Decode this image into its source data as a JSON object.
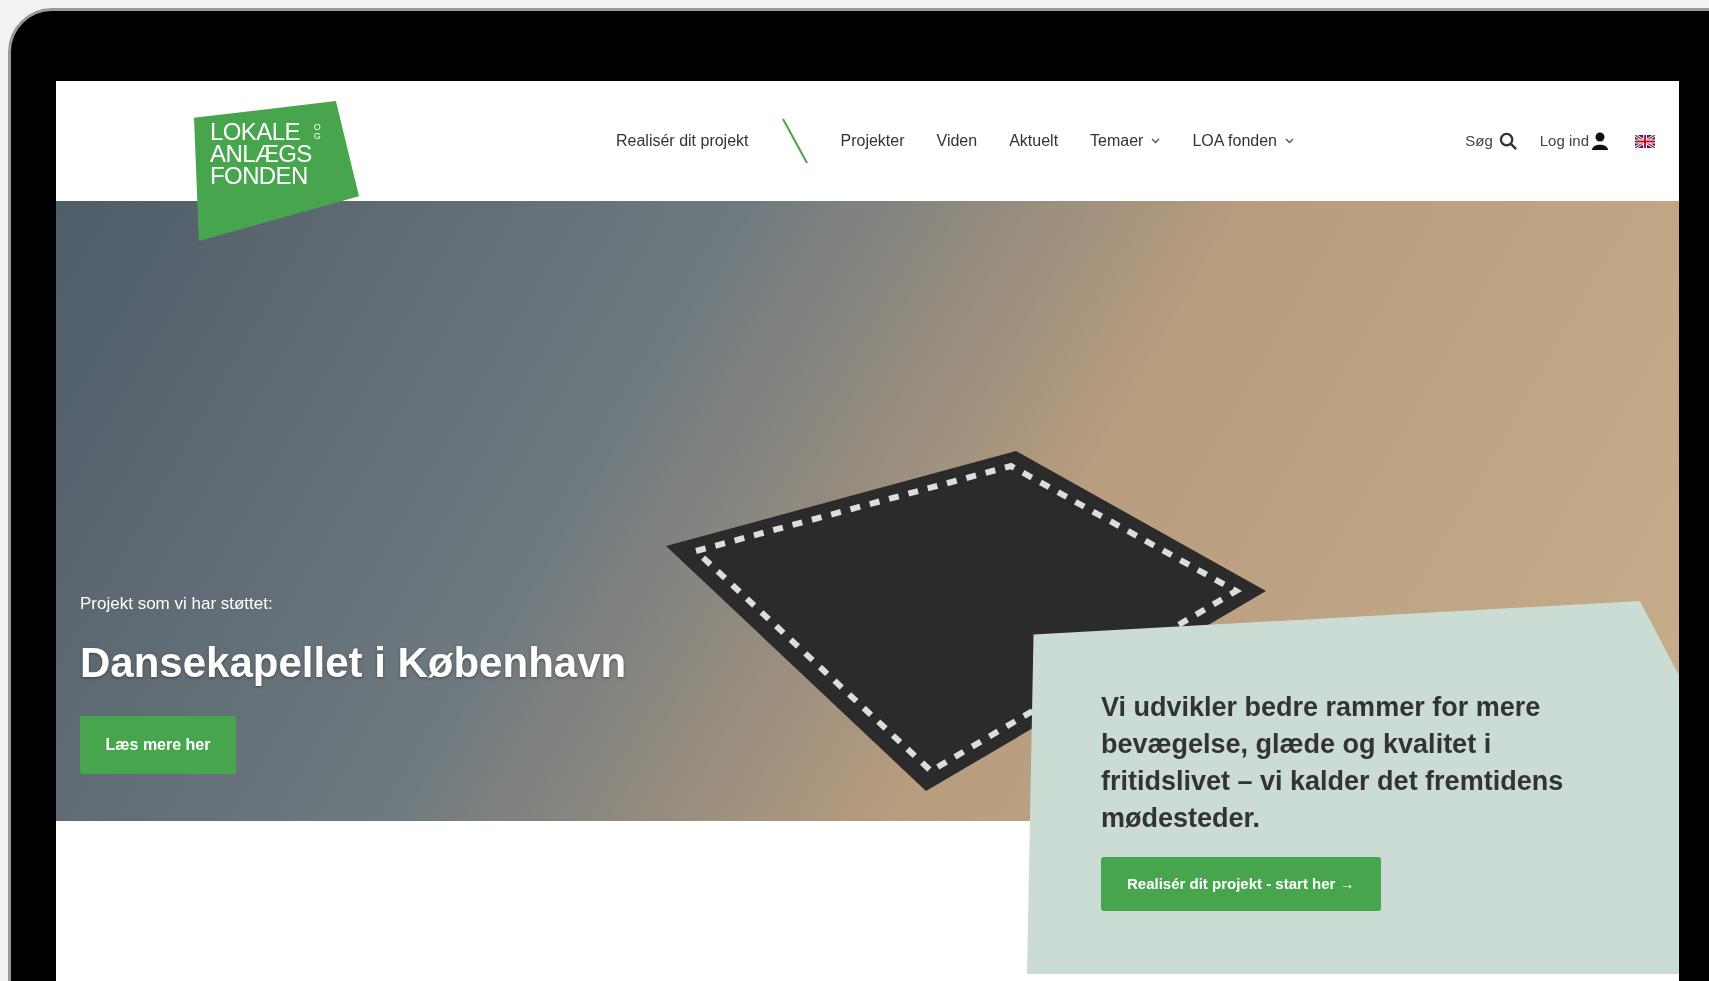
{
  "logo": {
    "lines": [
      "LOKALE",
      "ANLÆGS",
      "FONDEN"
    ],
    "small": "OG"
  },
  "nav": [
    {
      "label": "Realisér dit projekt",
      "kind": "link"
    },
    {
      "label": "Projekter",
      "kind": "link"
    },
    {
      "label": "Viden",
      "kind": "link"
    },
    {
      "label": "Aktuelt",
      "kind": "link"
    },
    {
      "label": "Temaer",
      "kind": "dropdown"
    },
    {
      "label": "LOA fonden",
      "kind": "dropdown"
    }
  ],
  "search": {
    "label": "Søg"
  },
  "login": {
    "label": "Log ind"
  },
  "hero": {
    "eyebrow": "Projekt som vi har støttet:",
    "title": "Dansekapellet i København",
    "button": "Læs mere her"
  },
  "card": {
    "text": "Vi udvikler bedre rammer for mere bevægelse, glæde og kvalitet i fritidslivet – vi kalder det fremtidens mødesteder.",
    "button": "Realisér dit projekt - start her →"
  }
}
